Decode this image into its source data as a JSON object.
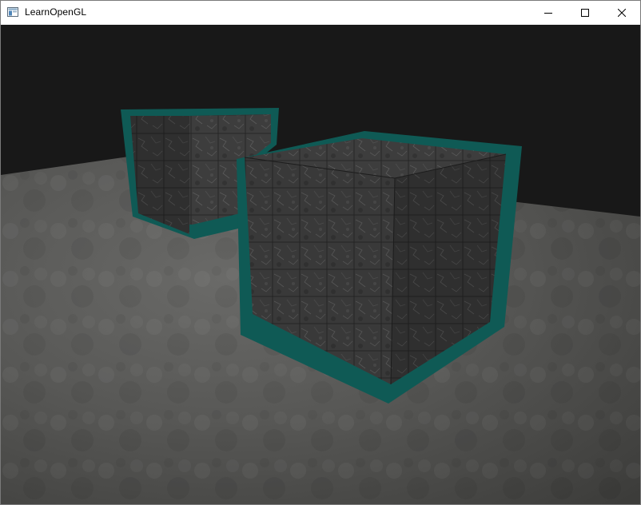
{
  "window": {
    "title": "LearnOpenGL",
    "icon": "app-window-icon",
    "controls": {
      "minimize_icon": "minimize-icon",
      "maximize_icon": "maximize-icon",
      "close_icon": "close-icon"
    }
  },
  "scene": {
    "background_color": "#181818",
    "floor_color": "#5a5a58",
    "outline_color": "#0f5a55",
    "cube_texture_color": "#3a3a3a",
    "objects": [
      "back-cube",
      "front-cube",
      "floor-plane"
    ]
  }
}
